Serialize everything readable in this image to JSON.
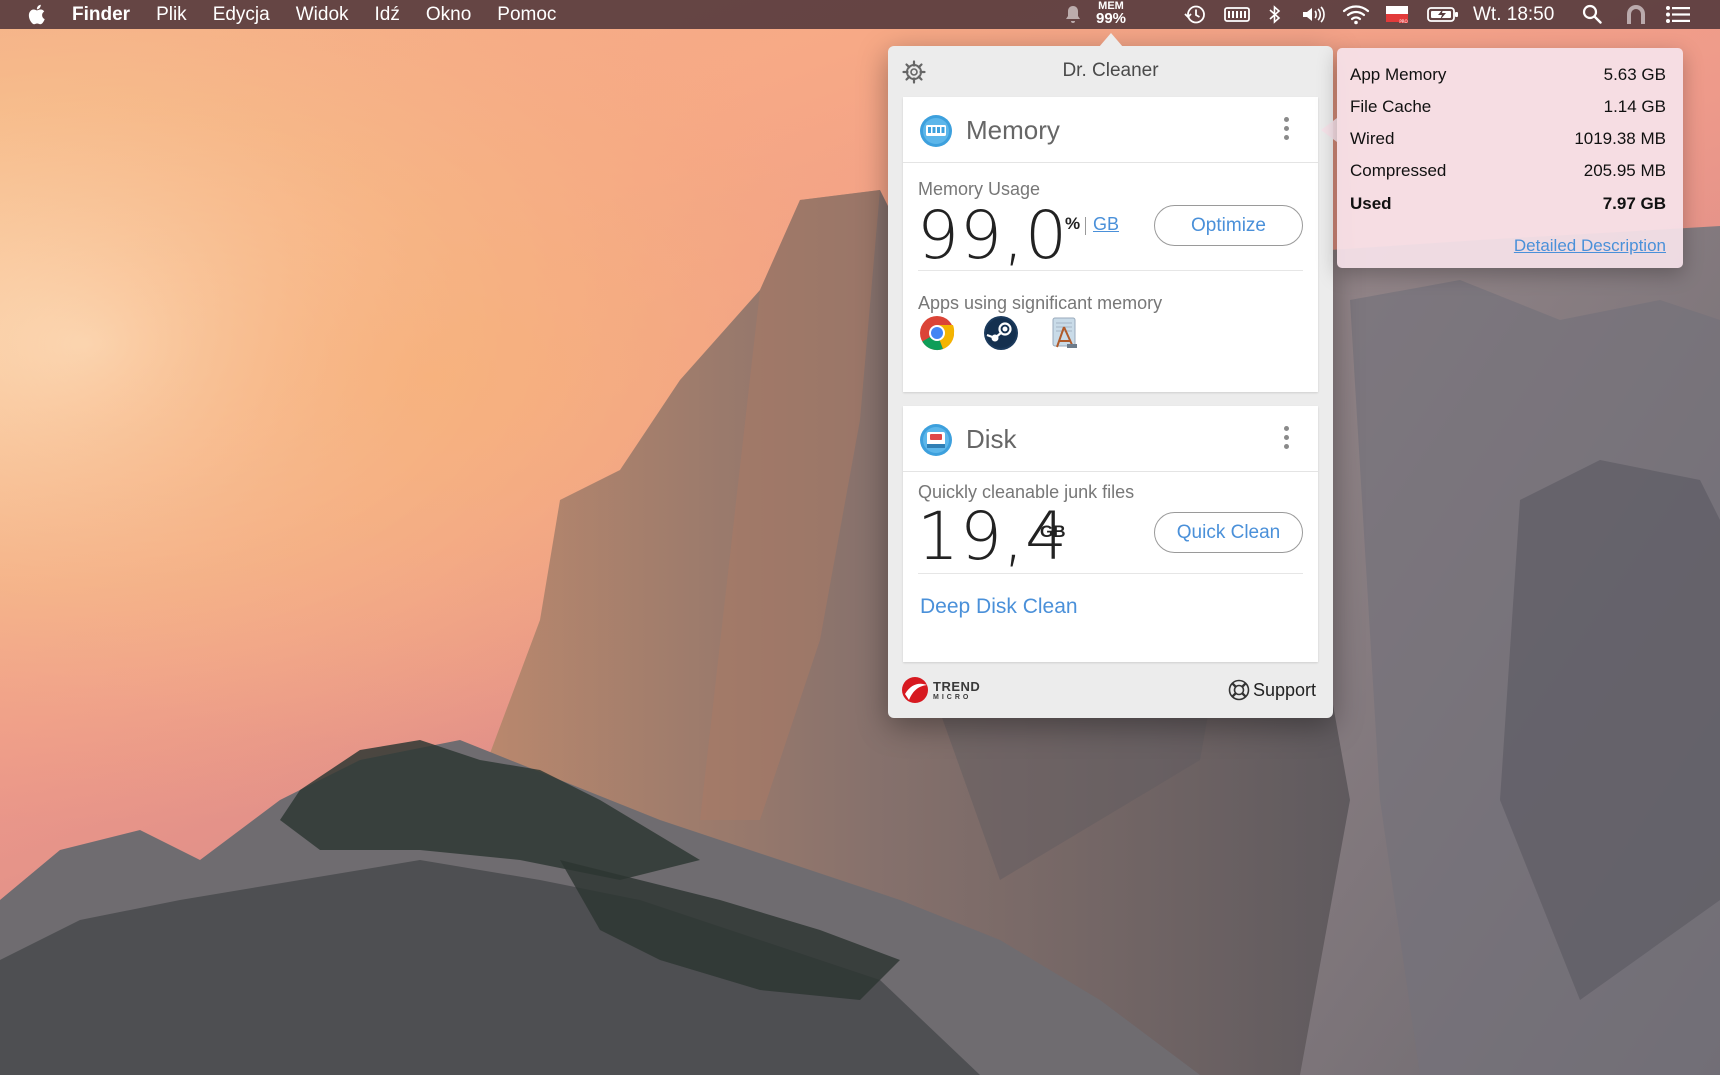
{
  "menubar": {
    "app_name": "Finder",
    "menus": [
      "Plik",
      "Edycja",
      "Widok",
      "Idź",
      "Okno",
      "Pomoc"
    ],
    "mem_label": "MEM",
    "mem_value": "99%",
    "clock": "Wt. 18:50"
  },
  "popover": {
    "title": "Dr. Cleaner",
    "memory": {
      "title": "Memory",
      "usage_label": "Memory Usage",
      "usage_value": "99,0",
      "unit_percent": "%",
      "unit_gb": "GB",
      "optimize_label": "Optimize",
      "apps_label": "Apps using significant memory",
      "apps": [
        "chrome-icon",
        "steam-icon",
        "xcode-instruments-icon"
      ]
    },
    "disk": {
      "title": "Disk",
      "junk_label": "Quickly cleanable junk files",
      "junk_value": "19,4",
      "junk_unit": "GB",
      "quick_clean_label": "Quick Clean",
      "deep_clean_label": "Deep Disk Clean"
    },
    "footer": {
      "brand_line1": "TREND",
      "brand_line2": "MICRO",
      "support_label": "Support"
    }
  },
  "tooltip": {
    "rows": [
      {
        "label": "App Memory",
        "value": "5.63 GB"
      },
      {
        "label": "File Cache",
        "value": "1.14 GB"
      },
      {
        "label": "Wired",
        "value": "1019.38 MB"
      },
      {
        "label": "Compressed",
        "value": "205.95 MB"
      },
      {
        "label": "Used",
        "value": "7.97 GB"
      }
    ],
    "link_label": "Detailed Description"
  },
  "colors": {
    "accent": "#4a90d9",
    "trend_red": "#d71920",
    "menubar": "#583c3e"
  }
}
